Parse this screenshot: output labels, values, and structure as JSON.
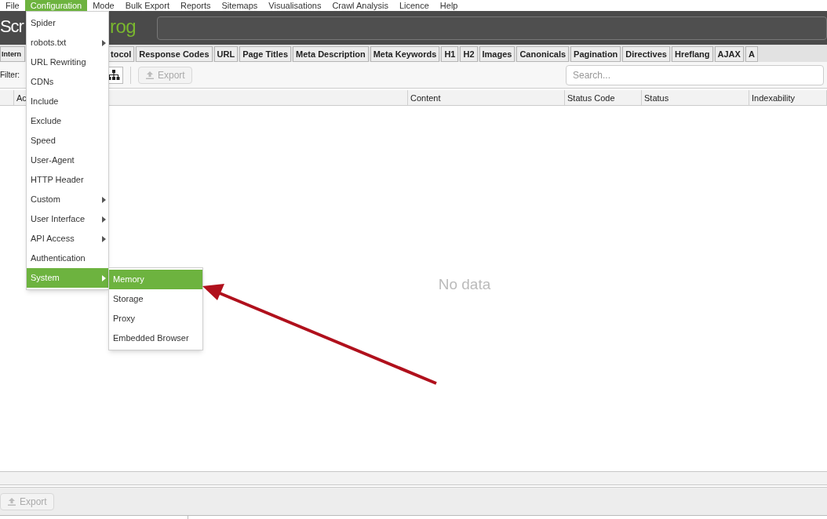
{
  "menu_bar": [
    {
      "label": "File",
      "selected": false
    },
    {
      "label": "Configuration",
      "selected": true
    },
    {
      "label": "Mode",
      "selected": false
    },
    {
      "label": "Bulk Export",
      "selected": false
    },
    {
      "label": "Reports",
      "selected": false
    },
    {
      "label": "Sitemaps",
      "selected": false
    },
    {
      "label": "Visualisations",
      "selected": false
    },
    {
      "label": "Crawl Analysis",
      "selected": false
    },
    {
      "label": "Licence",
      "selected": false
    },
    {
      "label": "Help",
      "selected": false
    }
  ],
  "logo": {
    "left": "Scr",
    "right": "rog"
  },
  "tabs": [
    {
      "label": "Intern"
    },
    {
      "label": "tocol"
    },
    {
      "label": "Response Codes"
    },
    {
      "label": "URL"
    },
    {
      "label": "Page Titles"
    },
    {
      "label": "Meta Description"
    },
    {
      "label": "Meta Keywords"
    },
    {
      "label": "H1"
    },
    {
      "label": "H2"
    },
    {
      "label": "Images"
    },
    {
      "label": "Canonicals"
    },
    {
      "label": "Pagination"
    },
    {
      "label": "Directives"
    },
    {
      "label": "Hreflang"
    },
    {
      "label": "AJAX"
    },
    {
      "label": "A"
    }
  ],
  "toolbar": {
    "filter_label": "Filter:",
    "export": {
      "label": "Export",
      "disabled": true
    },
    "search": {
      "placeholder": "Search..."
    }
  },
  "table": {
    "columns": [
      "",
      "Ac",
      "Content",
      "Status Code",
      "Status",
      "Indexability"
    ],
    "empty_text": "No data"
  },
  "bottom_toolbar": {
    "export": {
      "label": "Export",
      "disabled": true
    }
  },
  "dropdown": [
    {
      "label": "Spider",
      "submenu": false,
      "selected": false
    },
    {
      "label": "robots.txt",
      "submenu": true,
      "selected": false
    },
    {
      "label": "URL Rewriting",
      "submenu": false,
      "selected": false
    },
    {
      "label": "CDNs",
      "submenu": false,
      "selected": false
    },
    {
      "label": "Include",
      "submenu": false,
      "selected": false
    },
    {
      "label": "Exclude",
      "submenu": false,
      "selected": false
    },
    {
      "label": "Speed",
      "submenu": false,
      "selected": false
    },
    {
      "label": "User-Agent",
      "submenu": false,
      "selected": false
    },
    {
      "label": "HTTP Header",
      "submenu": false,
      "selected": false
    },
    {
      "label": "Custom",
      "submenu": true,
      "selected": false
    },
    {
      "label": "User Interface",
      "submenu": true,
      "selected": false
    },
    {
      "label": "API Access",
      "submenu": true,
      "selected": false
    },
    {
      "label": "Authentication",
      "submenu": false,
      "selected": false
    },
    {
      "label": "System",
      "submenu": true,
      "selected": true
    }
  ],
  "submenu": [
    {
      "label": "Memory",
      "selected": true
    },
    {
      "label": "Storage",
      "selected": false
    },
    {
      "label": "Proxy",
      "selected": false
    },
    {
      "label": "Embedded Browser",
      "selected": false
    }
  ]
}
